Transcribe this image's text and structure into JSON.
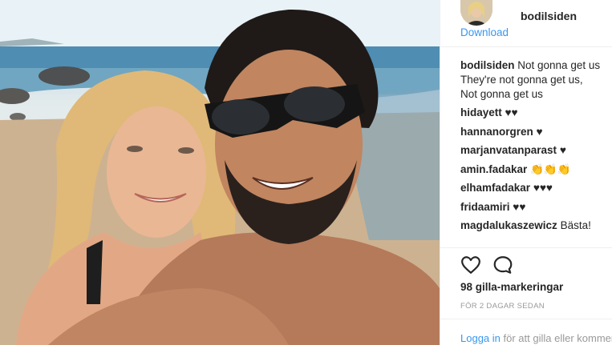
{
  "post": {
    "username": "bodilsiden",
    "download_label": "Download",
    "caption_lines": [
      "Not gonna get us",
      "They're not gonna get us,",
      "Not gonna get us"
    ],
    "comments": [
      {
        "user": "hidayett",
        "text": "♥♥"
      },
      {
        "user": "hannanorgren",
        "text": "♥"
      },
      {
        "user": "marjanvatanparast",
        "text": "♥"
      },
      {
        "user": "amin.fadakar",
        "text": "👏👏👏"
      },
      {
        "user": "elhamfadakar",
        "text": "♥♥♥"
      },
      {
        "user": "fridaamiri",
        "text": "♥♥"
      },
      {
        "user": "magdalukaszewicz",
        "text": "Bästa!"
      }
    ],
    "likes": "98 gilla-markeringar",
    "time_ago": "FÖR 2 DAGAR SEDAN",
    "login_link": "Logga in",
    "login_rest": " för att gilla eller kommentera."
  },
  "icons": {
    "like": "heart-outline-icon",
    "comment": "speech-bubble-icon"
  },
  "colors": {
    "link": "#3897f0",
    "text": "#262626",
    "muted": "#999999"
  }
}
